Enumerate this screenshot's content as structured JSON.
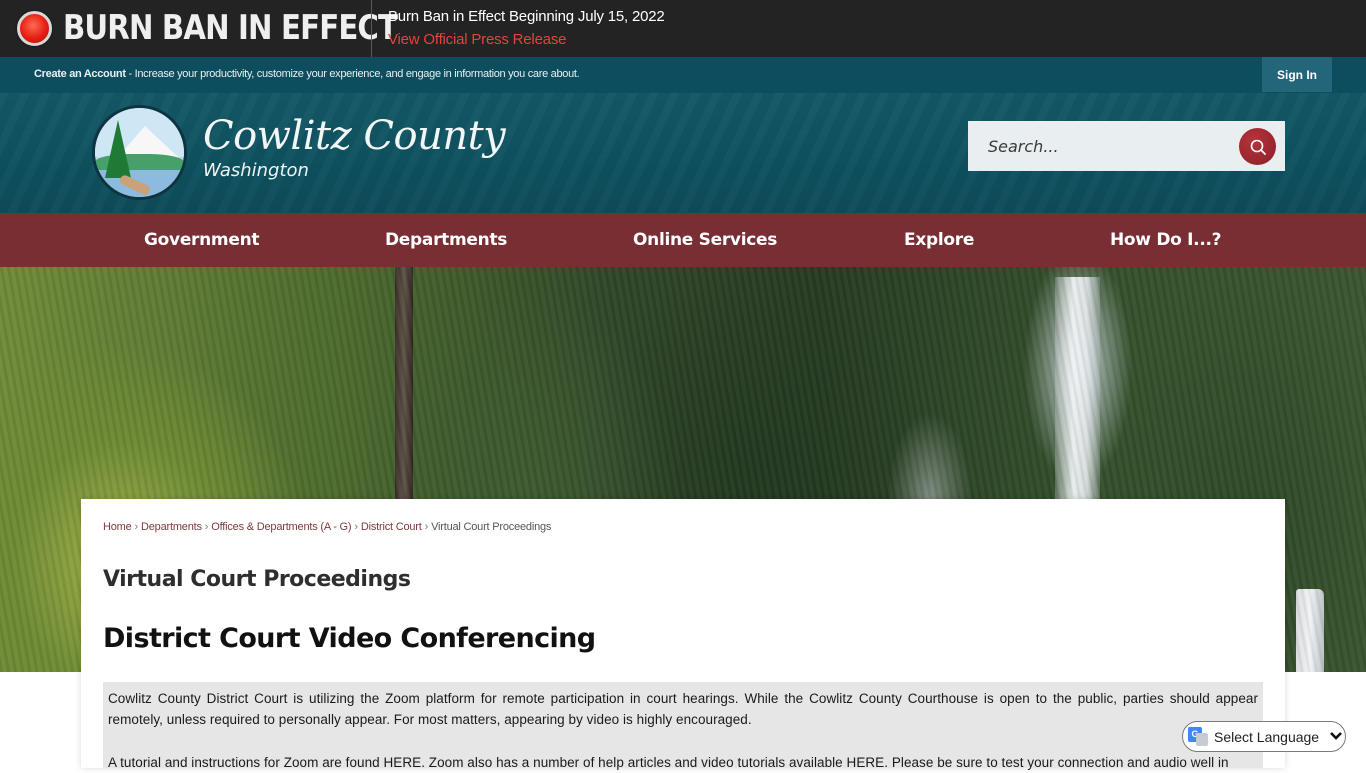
{
  "alert": {
    "title": "BURN BAN IN EFFECT",
    "message": "Burn Ban in Effect Beginning July 15, 2022",
    "link": "View Official Press Release",
    "icon": "red-alert-dot-icon",
    "accent_color": "#e2453a"
  },
  "account_bar": {
    "create_account": "Create an Account",
    "tagline": " - Increase your productivity, customize your experience, and engage in information you care about.",
    "sign_in": "Sign In"
  },
  "header": {
    "logo_name": "Cowlitz County",
    "logo_sub": "Washington",
    "search_placeholder": "Search...",
    "search_icon": "magnifier-icon"
  },
  "nav": {
    "items": [
      {
        "label": "Government"
      },
      {
        "label": "Departments"
      },
      {
        "label": "Online Services"
      },
      {
        "label": "Explore"
      },
      {
        "label": "How Do I...?"
      }
    ],
    "color": "#782e33"
  },
  "breadcrumb": {
    "items": [
      {
        "label": "Home"
      },
      {
        "label": "Departments"
      },
      {
        "label": "Offices & Departments (A - G)"
      },
      {
        "label": "District Court"
      }
    ],
    "current": "Virtual Court Proceedings",
    "separator": "›"
  },
  "main": {
    "page_title": "Virtual Court Proceedings",
    "section_title": "District Court Video Conferencing",
    "paragraphs": [
      "Cowlitz County District Court is utilizing the Zoom platform for remote participation in court hearings. While the Cowlitz County Courthouse is open to the public, parties should appear remotely, unless required to personally appear. For most matters, appearing by video is highly encouraged.",
      "A tutorial and instructions for Zoom are found HERE.  Zoom also has a number of help articles and video tutorials available HERE.  Please be sure to test your connection and audio well in"
    ]
  },
  "language_widget": {
    "label": "Select Language",
    "icon": "google-translate-icon"
  }
}
